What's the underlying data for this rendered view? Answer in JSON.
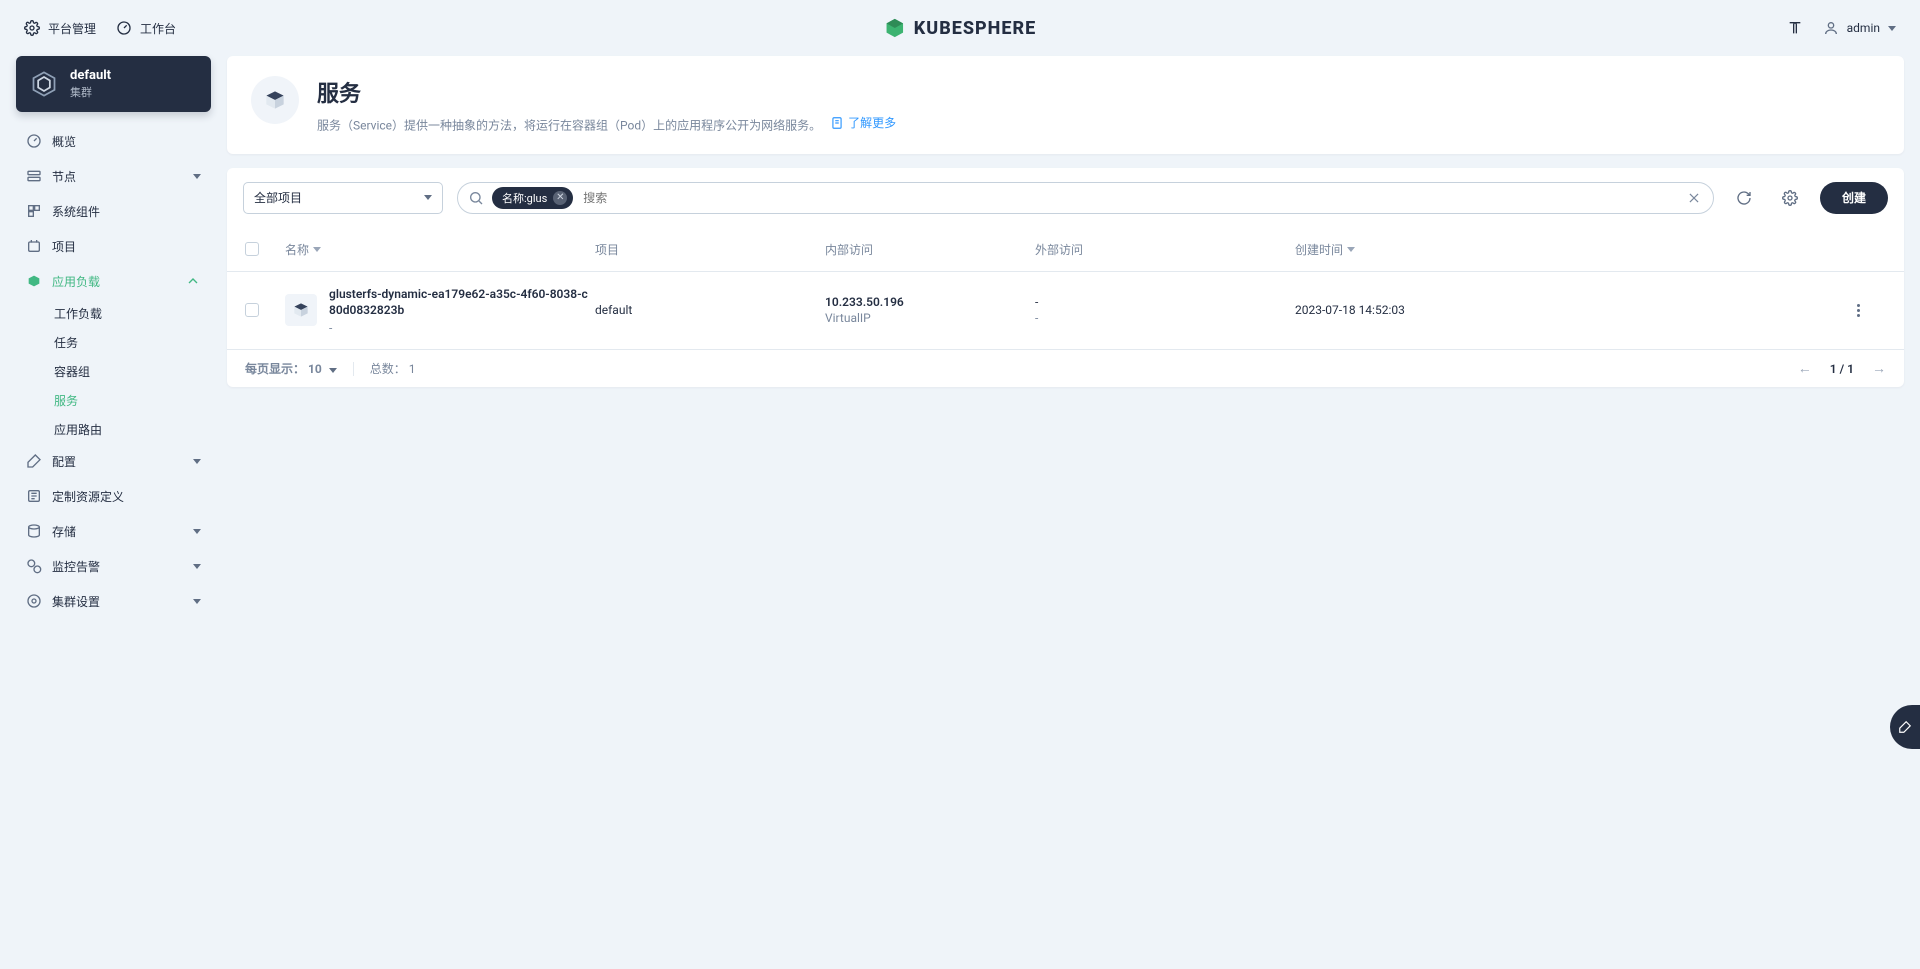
{
  "top": {
    "platform": "平台管理",
    "workbench": "工作台",
    "brand": "KUBESPHERE",
    "user": "admin"
  },
  "cluster": {
    "name": "default",
    "sub": "集群"
  },
  "nav": {
    "overview": "概览",
    "nodes": "节点",
    "components": "系统组件",
    "projects": "项目",
    "workloads": "应用负载",
    "workloads_sub": {
      "deployments": "工作负载",
      "jobs": "任务",
      "pods": "容器组",
      "services": "服务",
      "routes": "应用路由"
    },
    "config": "配置",
    "crd": "定制资源定义",
    "storage": "存储",
    "monitoring": "监控告警",
    "cluster_settings": "集群设置"
  },
  "hero": {
    "title": "服务",
    "desc": "服务（Service）提供一种抽象的方法，将运行在容器组（Pod）上的应用程序公开为网络服务。",
    "learn": "了解更多"
  },
  "toolbar": {
    "project_select": "全部项目",
    "search_placeholder": "搜索",
    "chip_label": "名称:glus",
    "create": "创建"
  },
  "table": {
    "headers": {
      "name": "名称",
      "project": "项目",
      "internal": "内部访问",
      "external": "外部访问",
      "created": "创建时间"
    },
    "rows": [
      {
        "name": "glusterfs-dynamic-ea179e62-a35c-4f60-8038-c80d0832823b",
        "sub": "-",
        "project": "default",
        "ip": "10.233.50.196",
        "ip_type": "VirtualIP",
        "external1": "-",
        "external2": "-",
        "created": "2023-07-18 14:52:03"
      }
    ],
    "footer": {
      "per_page_label": "每页显示：",
      "per_page_value": "10",
      "total_label": "总数：",
      "total_value": "1",
      "page": "1 / 1"
    }
  }
}
